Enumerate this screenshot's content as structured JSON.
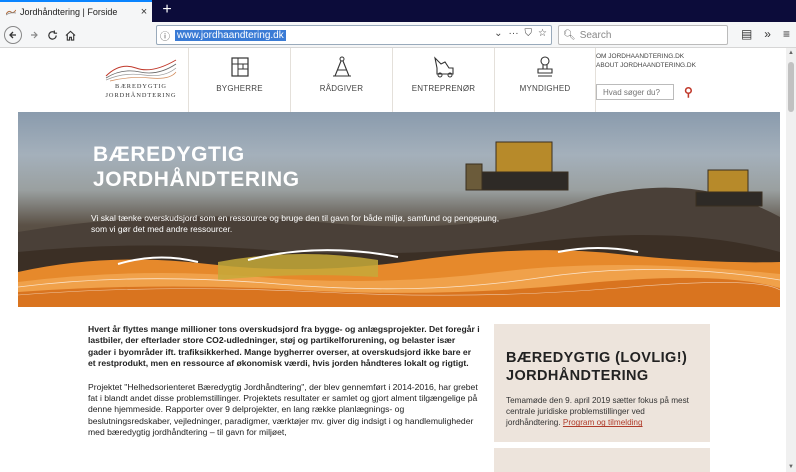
{
  "browser": {
    "tab_title": "Jordhåndtering | Forside",
    "tab_close": "×",
    "new_tab": "+",
    "url": "www.jordhaandtering.dk",
    "search_placeholder": "Search",
    "accent": "#0a84ff"
  },
  "site": {
    "logo_line1": "BÆREDYGTIG",
    "logo_line2": "JORDHÅNDTERING",
    "nav": [
      {
        "label": "BYGHERRE",
        "icon": "building-plan-icon"
      },
      {
        "label": "RÅDGIVER",
        "icon": "compass-icon"
      },
      {
        "label": "ENTREPRENØR",
        "icon": "excavator-icon"
      },
      {
        "label": "MYNDIGHED",
        "icon": "stamp-icon"
      }
    ],
    "header_link_1": "OM JORDHAANDTERING.DK",
    "header_link_2": "ABOUT JORDHAANDTERING.DK",
    "search_placeholder": "Hvad søger du?",
    "accent": "#c0392b"
  },
  "hero": {
    "title_line1": "BÆREDYGTIG",
    "title_line2": "JORDHÅNDTERING",
    "text": "Vi skal tænke overskudsjord som en ressource og bruge den til gavn for både miljø, samfund og pengepung, som vi gør det med andre ressourcer."
  },
  "content": {
    "lead": "Hvert år flyttes mange millioner tons overskudsjord fra bygge- og anlægsprojekter. Det foregår i lastbiler, der efterlader store CO2-udledninger, støj og partikelforurening, og belaster især gader i byområder ift. trafiksikkerhed. Mange bygherrer overser, at overskudsjord ikke bare er et restprodukt, men en ressource af økonomisk værdi, hvis jorden håndteres lokalt og rigtigt.",
    "body": "Projektet \"Helhedsorienteret Bæredygtig Jordhåndtering\", der blev gennemført i 2014-2016, har grebet fat i blandt andet disse problemstillinger. Projektets resultater er samlet og gjort alment tilgængelige på denne hjemmeside. Rapporter over 9 delprojekter, en lang række planlægnings- og beslutningsredskaber, vejledninger, paradigmer, værktøjer mv. giver dig indsigt i og handlemuligheder med bæredygtig jordhåndtering – til gavn for miljøet,"
  },
  "sidebox": {
    "title": "BÆREDYGTIG (LOVLIG!) JORDHÅNDTERING",
    "text": "Temamøde den 9. april 2019 sætter fokus på mest centrale juridiske problemstillinger ved jordhåndtering. ",
    "link": "Program og tilmelding",
    "bg": "#ede4dc"
  }
}
